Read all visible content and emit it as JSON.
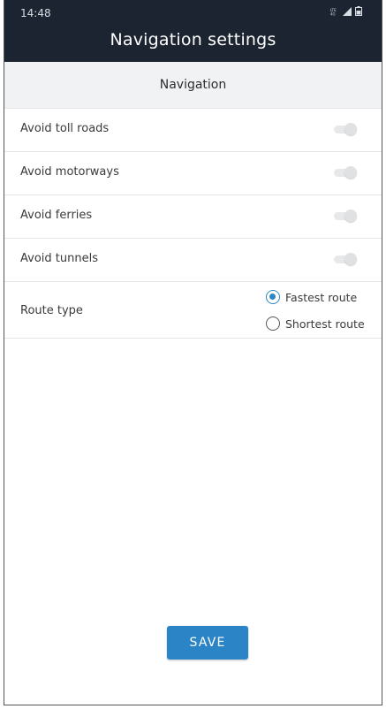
{
  "status_bar": {
    "time": "14:48",
    "icons": [
      "lte-icon",
      "signal-icon",
      "battery-icon"
    ]
  },
  "app_bar": {
    "title": "Navigation settings"
  },
  "section": {
    "title": "Navigation"
  },
  "settings": [
    {
      "label": "Avoid toll roads",
      "enabled": false
    },
    {
      "label": "Avoid motorways",
      "enabled": false
    },
    {
      "label": "Avoid ferries",
      "enabled": false
    },
    {
      "label": "Avoid tunnels",
      "enabled": false
    }
  ],
  "route_type": {
    "label": "Route type",
    "options": [
      {
        "label": "Fastest route",
        "selected": true
      },
      {
        "label": "Shortest route",
        "selected": false
      }
    ]
  },
  "save_button": {
    "label": "SAVE"
  },
  "colors": {
    "app_bar": "#1b2430",
    "accent": "#2b84c6",
    "section_bg": "#f1f2f4"
  }
}
